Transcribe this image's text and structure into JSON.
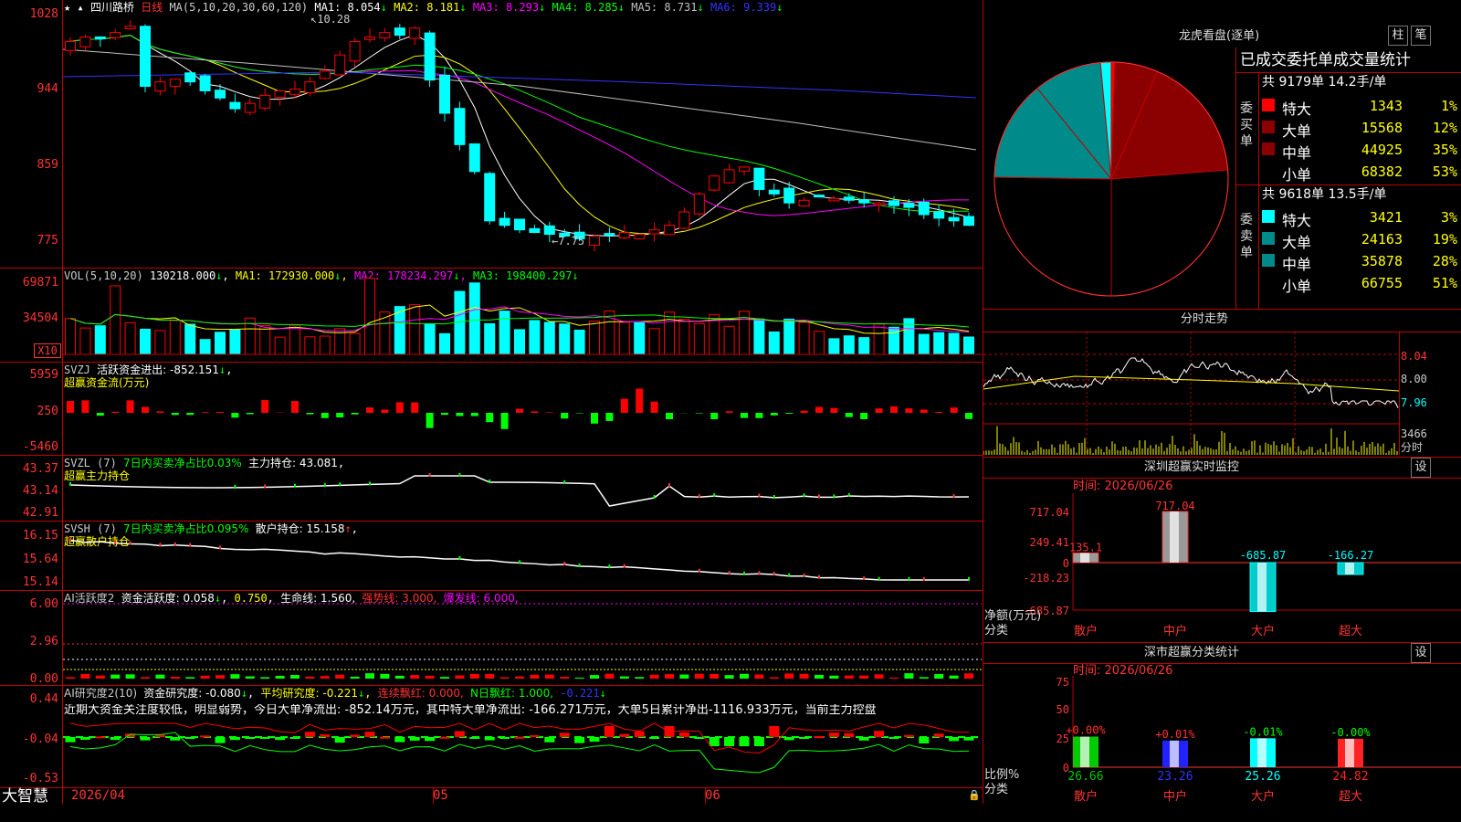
{
  "main": {
    "stock_name": "四川路桥",
    "period": "日线",
    "ma_params": "MA(5,10,20,30,60,120)",
    "ma": [
      {
        "label": "MA1:",
        "value": "8.054",
        "arrow": "↓",
        "color": "#ffffff"
      },
      {
        "label": "MA2:",
        "value": "8.181",
        "arrow": "↓",
        "color": "#ffff00"
      },
      {
        "label": "MA3:",
        "value": "8.293",
        "arrow": "↓",
        "color": "#ff00ff"
      },
      {
        "label": "MA4:",
        "value": "8.285",
        "arrow": "↓",
        "color": "#00ff00"
      },
      {
        "label": "MA5:",
        "value": "8.731",
        "arrow": "↓",
        "color": "#c0c0c0"
      },
      {
        "label": "MA6:",
        "value": "9.339",
        "arrow": "↓",
        "color": "#3333ff"
      }
    ],
    "y_ticks": [
      "1028",
      "944",
      "859",
      "775"
    ],
    "high_marker": "10.28",
    "low_marker": "←7.75"
  },
  "vol": {
    "title": "VOL(5,10,20)",
    "value": "130218.000",
    "ma1": "MA1: 172930.000",
    "ma2": "MA2: 178234.297",
    "ma3": "MA3: 198400.297",
    "y_ticks": [
      "69871",
      "34504"
    ],
    "unit": "X10"
  },
  "svzj": {
    "title": "SVZJ",
    "label": "活跃资金进出: -852.151",
    "subtitle": "超赢资金流(万元)",
    "y_ticks": [
      "5959",
      "250",
      "-5460"
    ]
  },
  "svzl": {
    "title": "SVZL (7)",
    "green_label": "7日内买卖净占比0.03%",
    "label": "主力持仓: 43.081",
    "subtitle": "超赢主力持仓",
    "y_ticks": [
      "43.37",
      "43.14",
      "42.91"
    ]
  },
  "svsh": {
    "title": "SVSH (7)",
    "green_label": "7日内买卖净占比0.095%",
    "label": "散户持仓: 15.158",
    "subtitle": "超赢散户持仓",
    "y_ticks": [
      "16.15",
      "15.64",
      "15.14"
    ]
  },
  "ai_active": {
    "title": "AI活跃度2",
    "label": "资金活跃度: 0.058",
    "v2": "0.750",
    "life": "生命线: 1.560,",
    "strong": "强势线: 3.000,",
    "burst": "爆发线: 6.000,",
    "y_ticks": [
      "6.00",
      "2.96",
      "0.00"
    ]
  },
  "ai_research": {
    "title": "AI研究度2(10)",
    "label": "资金研究度: -0.080",
    "avg": "平均研究度: -0.221",
    "cont": "连续飘红: 0.000,",
    "nday": "N日飘红: 1.000,",
    "last": "-0.221",
    "sentence": "近期大资金关注度较低，明显弱势，今日大单净流出: -852.14万元，其中特大单净流出: -166.271万元，大单5日累计净出-1116.933万元，当前主力控盘",
    "y_ticks": [
      "0.44",
      "-0.04",
      "-0.53"
    ]
  },
  "bottom": {
    "brand": "大智慧",
    "date": "2026/04",
    "month1": "05",
    "month2": "06"
  },
  "right": {
    "pie_title": "龙虎看盘(逐单)",
    "btn_column": "柱",
    "btn_pen": "笔",
    "table_title": "已成交委托单成交量统计",
    "buy": {
      "side_label": "委买单",
      "summary": "共 9179单 14.2手/单",
      "rows": [
        {
          "name": "特大",
          "count": "1343",
          "pct": "1%",
          "color": "#ff0000"
        },
        {
          "name": "大单",
          "count": "15568",
          "pct": "12%",
          "color": "#8b0000"
        },
        {
          "name": "中单",
          "count": "44925",
          "pct": "35%",
          "color": "#8b0000"
        },
        {
          "name": "小单",
          "count": "68382",
          "pct": "53%",
          "color": "#000000"
        }
      ]
    },
    "sell": {
      "side_label": "委卖单",
      "summary": "共 9618单 13.5手/单",
      "rows": [
        {
          "name": "特大",
          "count": "3421",
          "pct": "3%",
          "color": "#00ffff"
        },
        {
          "name": "大单",
          "count": "24163",
          "pct": "19%",
          "color": "#008b8b"
        },
        {
          "name": "中单",
          "count": "35878",
          "pct": "28%",
          "color": "#008b8b"
        },
        {
          "name": "小单",
          "count": "66755",
          "pct": "51%",
          "color": "#000000"
        }
      ]
    },
    "intraday": {
      "title": "分时走势",
      "y_ticks": [
        "8.04",
        "8.00",
        "7.96"
      ],
      "vol_tick": "3466",
      "vol_label": "分时"
    },
    "sz_monitor": {
      "title": "深圳超赢实时监控",
      "set_btn": "设",
      "time": "时间: 2026/06/26",
      "y_ticks": [
        "717.04",
        "249.41",
        "0",
        "-218.23",
        "-685.87"
      ],
      "axis_label1": "净额(万元)",
      "axis_label2": "分类",
      "bars": [
        {
          "name": "散户",
          "value": "135.1",
          "num": 135.1
        },
        {
          "name": "中户",
          "value": "717.04",
          "num": 717.04
        },
        {
          "name": "大户",
          "value": "-685.87",
          "num": -685.87
        },
        {
          "name": "超大",
          "value": "-166.27",
          "num": -166.27
        }
      ]
    },
    "sz_class": {
      "title": "深市超赢分类统计",
      "set_btn": "设",
      "time": "时间: 2026/06/26",
      "y_ticks": [
        "75",
        "50",
        "25",
        "0"
      ],
      "axis_label1": "比例%",
      "axis_label2": "分类",
      "bars": [
        {
          "name": "散户",
          "pct": "26.66",
          "chg": "+0.00%",
          "color": "#00cc00"
        },
        {
          "name": "中户",
          "pct": "23.26",
          "chg": "+0.01%",
          "color": "#2222ff"
        },
        {
          "name": "大户",
          "pct": "25.26",
          "chg": "-0.01%",
          "color": "#00ffff"
        },
        {
          "name": "超大",
          "pct": "24.82",
          "chg": "-0.00%",
          "color": "#ff2222"
        }
      ]
    }
  },
  "colors": {
    "grid": "#c00000",
    "up": "#ff0000",
    "down": "#00ffff",
    "label": "#ff3333"
  }
}
